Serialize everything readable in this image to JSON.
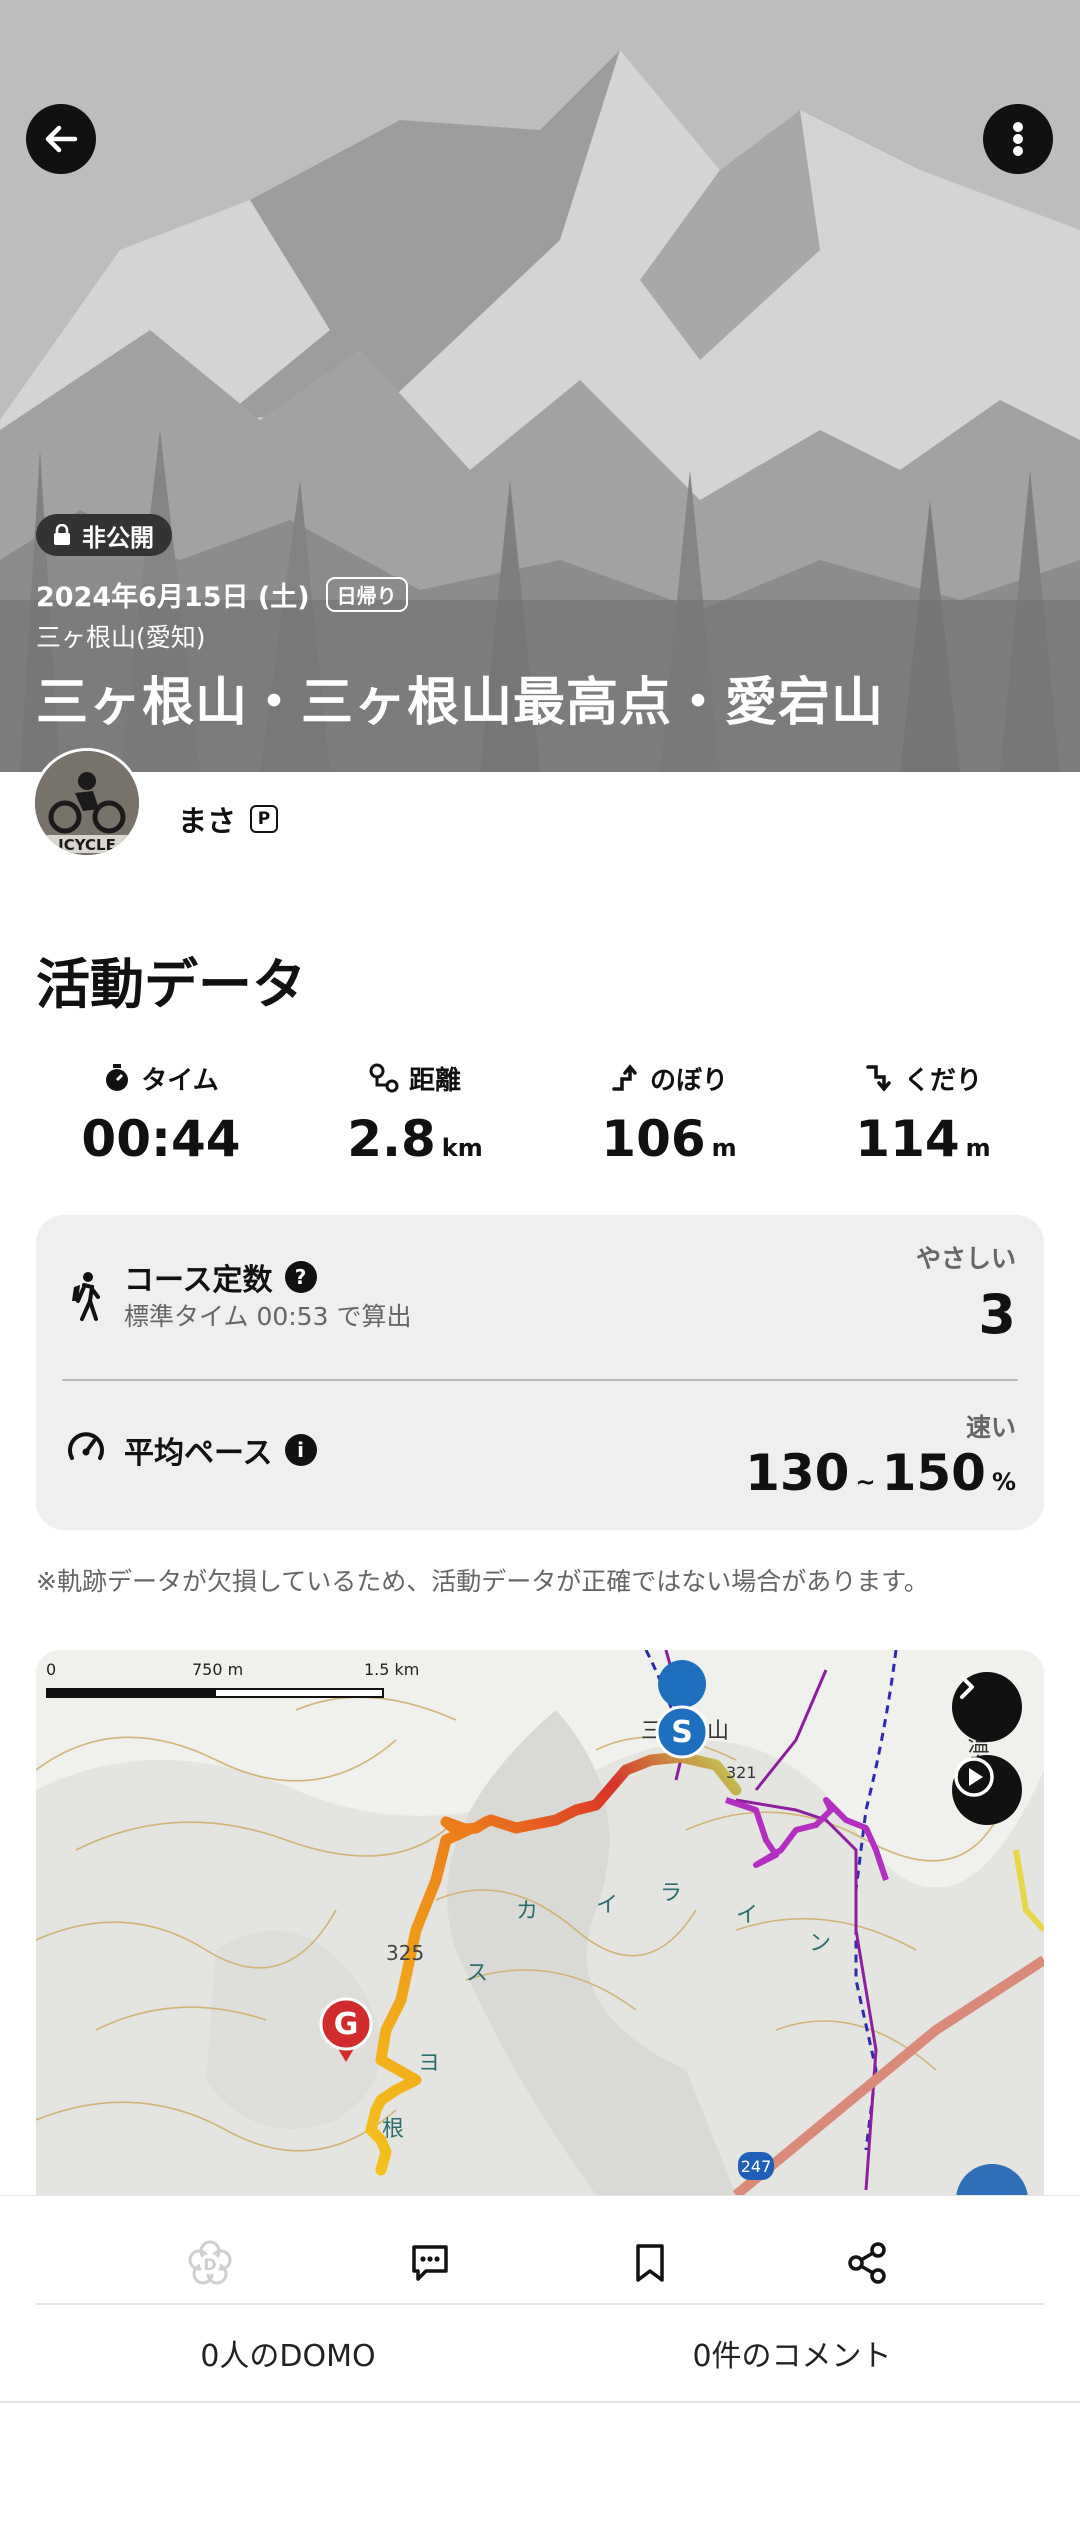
{
  "hero": {
    "visibility": "非公開",
    "date": "2024年6月15日 (土)",
    "trip_type": "日帰り",
    "area": "三ヶ根山(愛知)",
    "title": "三ヶ根山・三ヶ根山最高点・愛宕山",
    "icons": [
      "back-arrow-icon",
      "more-vertical-icon",
      "lock-icon"
    ]
  },
  "user": {
    "name": "まさ",
    "badge": "P"
  },
  "activity": {
    "section_title": "活動データ",
    "stats": [
      {
        "label": "タイム",
        "value": "00:44",
        "unit": "",
        "icon": "stopwatch-icon"
      },
      {
        "label": "距離",
        "value": "2.8",
        "unit": "km",
        "icon": "route-icon"
      },
      {
        "label": "のぼり",
        "value": "106",
        "unit": "m",
        "icon": "ascent-icon"
      },
      {
        "label": "くだり",
        "value": "114",
        "unit": "m",
        "icon": "descent-icon"
      }
    ],
    "course": {
      "title": "コース定数",
      "sub": "標準タイム 00:53 で算出",
      "level_label": "やさしい",
      "value": "3"
    },
    "pace": {
      "title": "平均ペース",
      "level_label": "速い",
      "value_from": "130",
      "tilde": "~",
      "value_to": "150",
      "unit": "%"
    },
    "notice": "※軌跡データが欠損しているため、活動データが正確ではない場合があります。"
  },
  "map": {
    "scale": [
      "0",
      "750 m",
      "1.5 km"
    ],
    "start_marker": "S",
    "goal_marker": "G",
    "labels": {
      "mountain": "三ヶ根山",
      "elev": "325",
      "elev2": "321",
      "road": "247",
      "skyline": [
        "カ",
        "イ",
        "ラ",
        "イ",
        "ン",
        "ス",
        "ヨ",
        "根"
      ],
      "spa": "原温泉"
    }
  },
  "bottom": {
    "domo_count": "0人のDOMO",
    "comment_count": "0件のコメント"
  },
  "colors": {
    "hero_bg": "#9a9a9a",
    "track_start": "#d9322a",
    "track_mid": "#f0a019",
    "track_end": "#f3c31c",
    "purple_route": "#9c1fa8",
    "start_marker": "#1f6fbf",
    "goal_marker": "#d12b2b"
  }
}
